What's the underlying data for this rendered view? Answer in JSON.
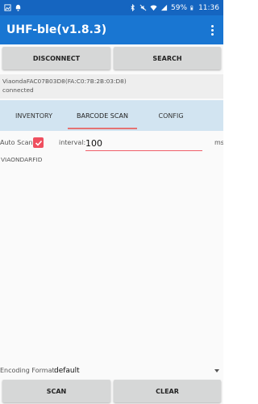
{
  "status_bar": {
    "battery": "59%",
    "time": "11:36"
  },
  "app": {
    "title": "UHF-ble(v1.8.3)"
  },
  "actions": {
    "disconnect_label": "DISCONNECT",
    "search_label": "SEARCH"
  },
  "device": {
    "line": "ViaondaFAC07B03D8(FA:C0:7B:2B:03:D8)",
    "status": "connected"
  },
  "tabs": [
    {
      "label": "INVENTORY"
    },
    {
      "label": "BARCODE SCAN"
    },
    {
      "label": "CONFIG"
    }
  ],
  "barcode_scan": {
    "auto_scan_label": "Auto Scan",
    "auto_scan_checked": true,
    "interval_label": "interval:",
    "interval_value": "100",
    "interval_unit": "ms",
    "results": [
      "VIAONDARFID"
    ]
  },
  "encoding": {
    "label": "Encoding Format",
    "value": "default"
  },
  "bottom": {
    "scan_label": "SCAN",
    "clear_label": "CLEAR"
  },
  "colors": {
    "status_bar": "#1565c0",
    "app_bar": "#1976d2",
    "accent": "#ef4f5f",
    "tab_background": "#d2e4f1"
  }
}
